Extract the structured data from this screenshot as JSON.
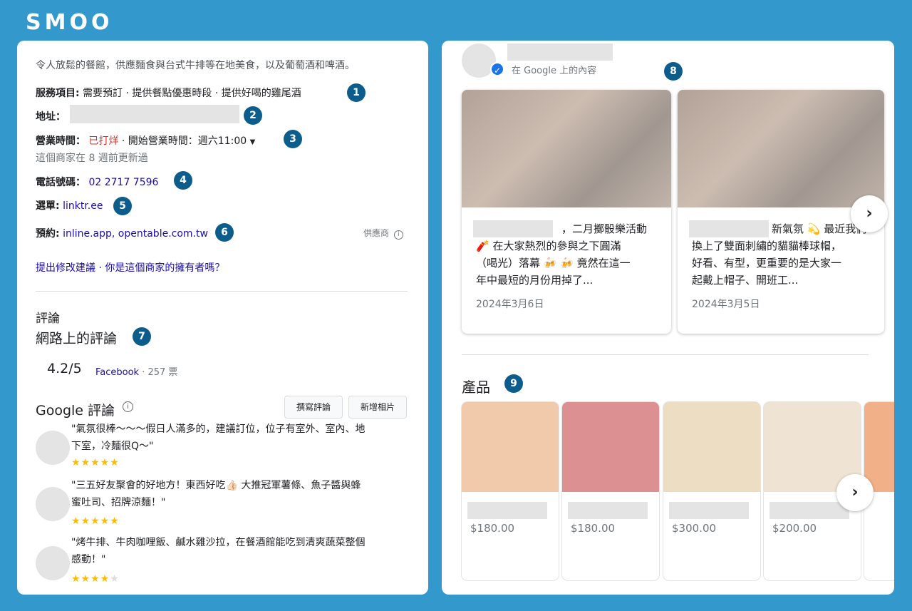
{
  "logo": "SMOO",
  "left": {
    "description": "令人放鬆的餐館，供應麵食與台式牛排等在地美食，以及葡萄酒和啤酒。",
    "services_label": "服務項目:",
    "services_value": "需要預訂 · 提供餐點優惠時段 · 提供好喝的雞尾酒",
    "address_label": "地址：",
    "hours_label": "營業時間：",
    "hours_status": "已打烊",
    "hours_open": " · 開始營業時間：週六11:00",
    "hours_updated": "這個商家在 8 週前更新過",
    "phone_label": "電話號碼：",
    "phone_value": "02 2717 7596",
    "menu_label": "選單:",
    "menu_value": "linktr.ee",
    "booking_label": "預約:",
    "booking_value": "inline.app, opentable.com.tw",
    "provider_label": "供應商",
    "suggest_link": "提出修改建議 · 你是這個商家的擁有者嗎？",
    "reviews_heading": "評論",
    "web_reviews_heading": "網路上的評論",
    "fb_score": "4.2/5",
    "fb_source": "Facebook",
    "fb_votes": " · 257 票",
    "google_reviews_heading": "Google 評論",
    "write_review_button": "撰寫評論",
    "add_photo_button": "新增相片",
    "reviews": [
      {
        "line1": "\"氣氛很棒～～～假日人滿多的，建議訂位，位子有室外、室內、地",
        "line2": "下室，冷麵很Q～\"",
        "stars": 5
      },
      {
        "line1": "\"三五好友聚會的好地方！東西好吃👍🏻 大推冠軍薯條、魚子醬與蜂",
        "line2": "蜜吐司、招牌涼麵！\"",
        "stars": 5
      },
      {
        "line1": "\"烤牛排、牛肉咖哩飯、鹹水雞沙拉，在餐酒館能吃到清爽蔬菜整個",
        "line2": "感動！\"",
        "stars": 4
      }
    ]
  },
  "badges": [
    "1",
    "2",
    "3",
    "4",
    "5",
    "6",
    "7",
    "8",
    "9"
  ],
  "right": {
    "source_label": "在 Google 上的內容",
    "posts": [
      {
        "text_suffix": "，二月擲骰樂活動",
        "line2": "🧨 在大家熱烈的參與之下圓滿",
        "line3": "（喝光）落幕 🍻 🍻 竟然在這一",
        "line4": "年中最短的月份用掉了...",
        "date": "2024年3月6日"
      },
      {
        "text_suffix": "新氣氛 💫 最近我們",
        "line2": "換上了雙面刺繡的貓貓棒球帽，",
        "line3": "好看、有型，更重要的是大家一",
        "line4": "起戴上帽子、開班工...",
        "date": "2024年3月5日"
      }
    ],
    "products_heading": "產品",
    "products": [
      {
        "price": "$180.00",
        "color": "#e8a673"
      },
      {
        "price": "$180.00",
        "color": "#c5474a"
      },
      {
        "price": "$300.00",
        "color": "#e2c79c"
      },
      {
        "price": "$200.00",
        "color": "#e5d3b8"
      }
    ]
  },
  "colors": {
    "background": "#3399CC",
    "badge": "#0d5d8c",
    "link": "#1a0dab",
    "closed": "#d93025",
    "star": "#fbbc04"
  }
}
